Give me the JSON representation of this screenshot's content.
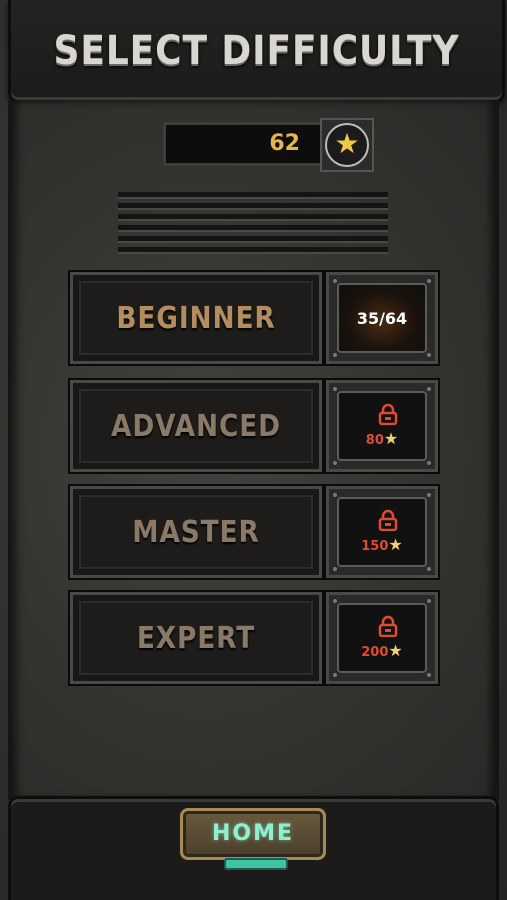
{
  "header": {
    "title": "SELECT DIFFICULTY"
  },
  "stars": {
    "count": "62",
    "icon": "star-icon"
  },
  "difficulties": [
    {
      "label": "BEGINNER",
      "status": "unlocked",
      "progress": "35/64"
    },
    {
      "label": "ADVANCED",
      "status": "locked",
      "cost": "80",
      "cost_icon": "star-icon"
    },
    {
      "label": "MASTER",
      "status": "locked",
      "cost": "150",
      "cost_icon": "star-icon"
    },
    {
      "label": "EXPERT",
      "status": "locked",
      "cost": "200",
      "cost_icon": "star-icon"
    }
  ],
  "footer": {
    "home_label": "HOME"
  },
  "colors": {
    "gold": "#e7b547",
    "lock_red": "#e04b35",
    "home_text": "#8ff0d0"
  }
}
